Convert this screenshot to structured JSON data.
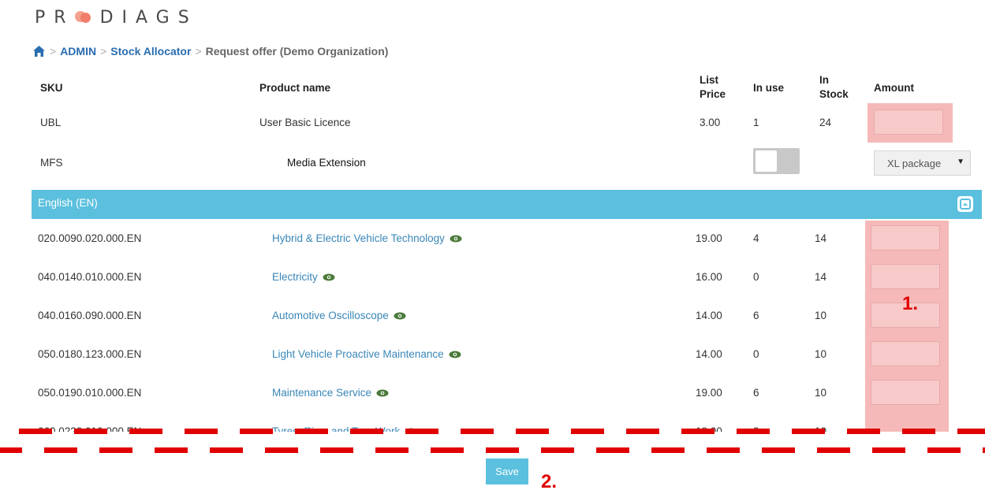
{
  "logo": {
    "text_left": "PR",
    "text_right": "DIAGS"
  },
  "breadcrumb": {
    "home_icon": "home-icon",
    "items": [
      "ADMIN",
      "Stock Allocator"
    ],
    "current": "Request offer (Demo Organization)",
    "separator": ">"
  },
  "table": {
    "headers": {
      "sku": "SKU",
      "product": "Product name",
      "list_price_1": "List",
      "list_price_2": "Price",
      "in_use": "In use",
      "in_stock_1": "In",
      "in_stock_2": "Stock",
      "amount": "Amount"
    },
    "top_rows": [
      {
        "sku": "UBL",
        "product": "User Basic Licence",
        "price": "3.00",
        "in_use": "1",
        "in_stock": "24"
      },
      {
        "sku": "MFS",
        "product": "Media Extension",
        "package": "XL package"
      }
    ],
    "group": {
      "label": "English (EN)",
      "icon": "collapse-up-icon"
    },
    "rows": [
      {
        "sku": "020.0090.020.000.EN",
        "product": "Hybrid & Electric Vehicle Technology",
        "price": "19.00",
        "in_use": "4",
        "in_stock": "14"
      },
      {
        "sku": "040.0140.010.000.EN",
        "product": "Electricity",
        "price": "16.00",
        "in_use": "0",
        "in_stock": "14"
      },
      {
        "sku": "040.0160.090.000.EN",
        "product": "Automotive Oscilloscope",
        "price": "14.00",
        "in_use": "6",
        "in_stock": "10"
      },
      {
        "sku": "050.0180.123.000.EN",
        "product": "Light Vehicle Proactive Maintenance",
        "price": "14.00",
        "in_use": "0",
        "in_stock": "10"
      },
      {
        "sku": "050.0190.010.000.EN",
        "product": "Maintenance Service",
        "price": "19.00",
        "in_use": "6",
        "in_stock": "10"
      },
      {
        "sku": "060.0220.010.000.EN",
        "product": "Tyres, Rims and Tyre Work",
        "price": "18.00",
        "in_use": "3",
        "in_stock": "10"
      }
    ]
  },
  "save_label": "Save",
  "annotations": {
    "one": "1.",
    "two": "2."
  },
  "colors": {
    "accent": "#5bc0de",
    "link": "#3a86b8",
    "highlight": "#f6b9b9",
    "dash": "#e00000",
    "eye": "#4a7a3a"
  }
}
